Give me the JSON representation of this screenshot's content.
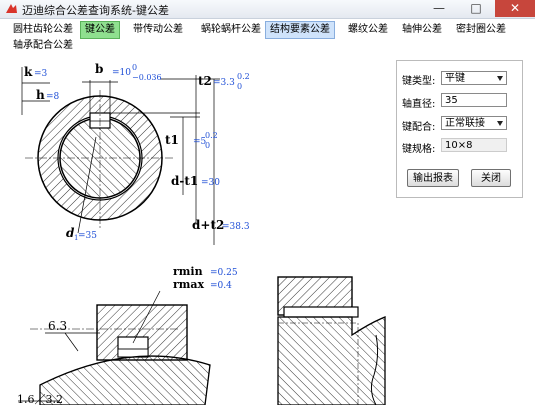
{
  "window": {
    "title": "迈迪综合公差查询系统-键公差",
    "minimize": "—",
    "maximize": "□",
    "close": "✕"
  },
  "tabs": [
    {
      "label": "圆柱齿轮公差"
    },
    {
      "label": "键公差"
    },
    {
      "label": "带传动公差"
    },
    {
      "label": "蜗轮蜗杆公差"
    },
    {
      "label": "结构要素公差"
    },
    {
      "label": "螺纹公差"
    },
    {
      "label": "轴伸公差"
    },
    {
      "label": "密封圈公差"
    },
    {
      "label": "轴承配合公差"
    }
  ],
  "form": {
    "key_type_label": "键类型:",
    "key_type_value": "平键",
    "shaft_dia_label": "轴直径:",
    "shaft_dia_value": "35",
    "fit_label": "键配合:",
    "fit_value": "正常联接",
    "spec_label": "键规格:",
    "spec_value": "10×8",
    "export_button": "输出报表",
    "close_button": "关闭"
  },
  "drawing": {
    "k_label": "k",
    "k_value": "=3",
    "h_label": "h",
    "h_value": "=8",
    "b_label": "b",
    "b_value": "=10",
    "b_tol_upper": "0",
    "b_tol_lower": "−0.036",
    "t2_label": "t2",
    "t2_value": "=3.3",
    "t2_tol_upper": "0.2",
    "t2_tol_lower": "0",
    "t1_label": "t1",
    "t1_value": "=5",
    "t1_tol_upper": "0.2",
    "t1_tol_lower": "0",
    "d_t1_label": "d-t1",
    "d_t1_value": "=30",
    "d_t2_label": "d+t2",
    "d_t2_value": "=38.3",
    "d1_label": "d",
    "d1_sub": "1",
    "d1_value": "=35",
    "rmin_label": "rmin",
    "rmin_value": "=0.25",
    "rmax_label": "rmax",
    "rmax_value": "=0.4",
    "rough1": "6.3",
    "rough2": "1.6／3.2"
  }
}
